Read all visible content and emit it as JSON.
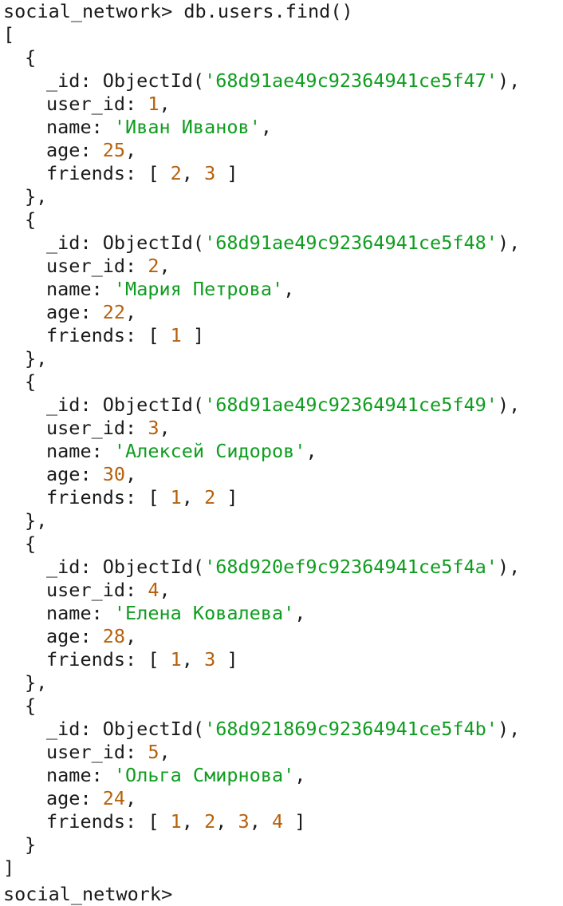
{
  "prompt": "social_network>",
  "command": "db.users.find()",
  "users": [
    {
      "oid": "68d91ae49c92364941ce5f47",
      "user_id": "1",
      "name": "Иван Иванов",
      "age": "25",
      "friends": [
        "2",
        "3"
      ]
    },
    {
      "oid": "68d91ae49c92364941ce5f48",
      "user_id": "2",
      "name": "Мария Петрова",
      "age": "22",
      "friends": [
        "1"
      ]
    },
    {
      "oid": "68d91ae49c92364941ce5f49",
      "user_id": "3",
      "name": "Алексей Сидоров",
      "age": "30",
      "friends": [
        "1",
        "2"
      ]
    },
    {
      "oid": "68d920ef9c92364941ce5f4a",
      "user_id": "4",
      "name": "Елена Ковалева",
      "age": "28",
      "friends": [
        "1",
        "3"
      ]
    },
    {
      "oid": "68d921869c92364941ce5f4b",
      "user_id": "5",
      "name": "Ольга Смирнова",
      "age": "24",
      "friends": [
        "1",
        "2",
        "3",
        "4"
      ]
    }
  ],
  "next_prompt": "social_network>"
}
